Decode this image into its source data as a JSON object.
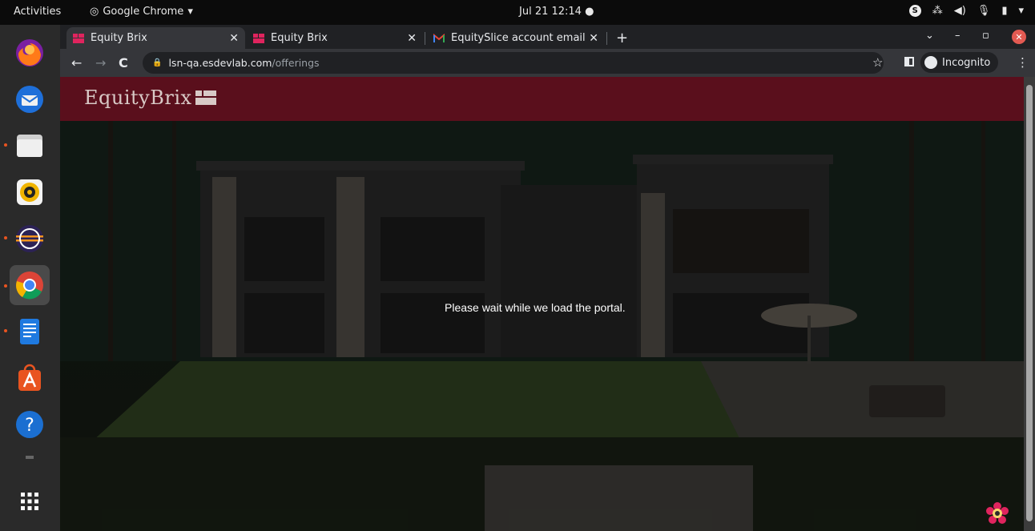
{
  "topbar": {
    "activities": "Activities",
    "app_name": "Google Chrome",
    "clock": "Jul 21  12:14"
  },
  "dock": {
    "items": [
      {
        "name": "firefox-icon"
      },
      {
        "name": "thunderbird-icon"
      },
      {
        "name": "files-icon"
      },
      {
        "name": "rhythmbox-icon"
      },
      {
        "name": "eclipse-icon"
      },
      {
        "name": "chrome-icon"
      },
      {
        "name": "writer-icon"
      },
      {
        "name": "software-center-icon"
      },
      {
        "name": "help-icon"
      },
      {
        "name": "show-apps-icon"
      }
    ]
  },
  "browser": {
    "tabs": [
      {
        "title": "Equity Brix",
        "active": true
      },
      {
        "title": "Equity Brix",
        "active": false
      },
      {
        "title": "EquitySlice account email",
        "active": false
      }
    ],
    "url_host": "lsn-qa.esdevlab.com",
    "url_path": "/offerings",
    "incognito_label": "Incognito"
  },
  "page": {
    "logo_text": "EquityBrix",
    "loading_message": "Please wait while we load the portal.",
    "header_color": "#5a0f1c"
  }
}
